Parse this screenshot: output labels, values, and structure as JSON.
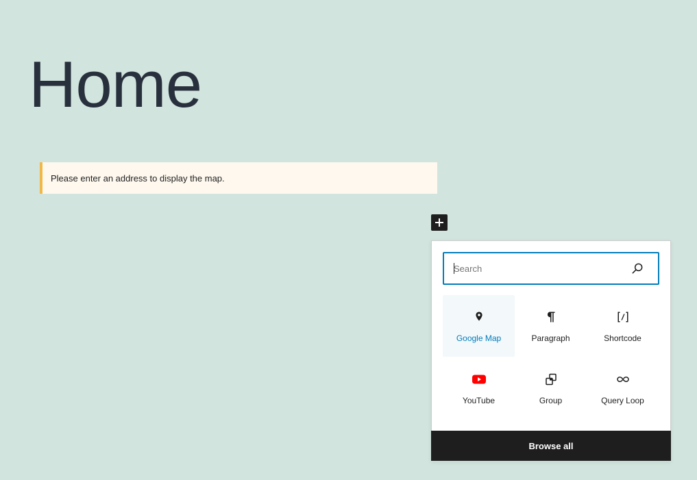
{
  "page": {
    "title": "Home"
  },
  "notice": {
    "text": "Please enter an address to display the map."
  },
  "inserter": {
    "toggle_icon": "plus-icon",
    "search": {
      "placeholder": "Search",
      "value": "",
      "icon": "search-icon"
    },
    "blocks": [
      {
        "label": "Google Map",
        "icon": "map-pin-icon",
        "active": true
      },
      {
        "label": "Paragraph",
        "icon": "paragraph-icon",
        "active": false
      },
      {
        "label": "Shortcode",
        "icon": "shortcode-icon",
        "active": false
      },
      {
        "label": "YouTube",
        "icon": "youtube-icon",
        "active": false
      },
      {
        "label": "Group",
        "icon": "group-icon",
        "active": false
      },
      {
        "label": "Query Loop",
        "icon": "loop-icon",
        "active": false
      }
    ],
    "browse_all_label": "Browse all"
  },
  "colors": {
    "background": "#d1e4dd",
    "accent": "#007cba",
    "notice_border": "#f0b849",
    "youtube_red": "#ff0000",
    "dark": "#1e1e1e"
  }
}
